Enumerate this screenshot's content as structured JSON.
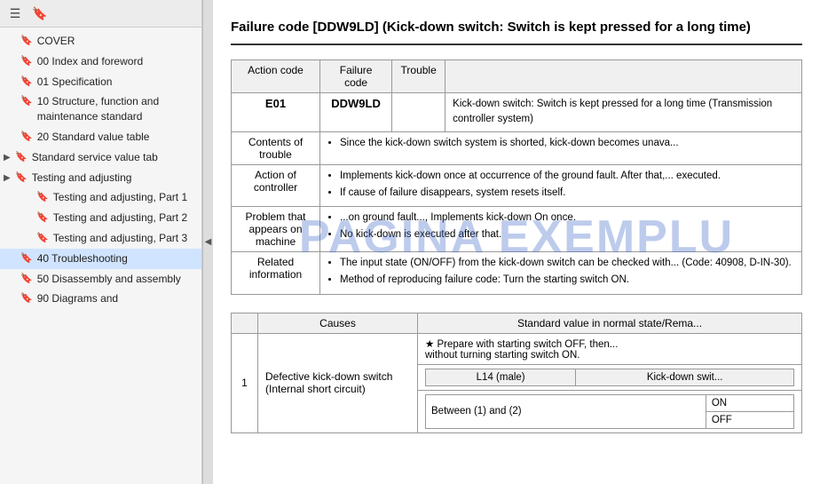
{
  "sidebar": {
    "toolbar": {
      "menu_icon": "☰",
      "bookmark_icon": "🔖"
    },
    "items": [
      {
        "id": "cover",
        "label": "COVER",
        "has_arrow": false,
        "active": false
      },
      {
        "id": "00-index",
        "label": "00 Index and foreword",
        "has_arrow": false,
        "active": false
      },
      {
        "id": "01-spec",
        "label": "01 Specification",
        "has_arrow": false,
        "active": false
      },
      {
        "id": "10-structure",
        "label": "10 Structure, function and maintenance standard",
        "has_arrow": false,
        "active": false
      },
      {
        "id": "20-standard",
        "label": "20 Standard value table",
        "has_arrow": false,
        "active": false
      },
      {
        "id": "standard-service",
        "label": "Standard service value tab",
        "has_arrow": true,
        "active": false
      },
      {
        "id": "testing-adjusting",
        "label": "Testing and adjusting",
        "has_arrow": true,
        "active": false
      },
      {
        "id": "testing-part1",
        "label": "Testing and adjusting, Part 1",
        "has_arrow": false,
        "active": false
      },
      {
        "id": "testing-part2",
        "label": "Testing and adjusting, Part 2",
        "has_arrow": false,
        "active": false
      },
      {
        "id": "testing-part3",
        "label": "Testing and adjusting, Part 3",
        "has_arrow": false,
        "active": false
      },
      {
        "id": "40-trouble",
        "label": "40 Troubleshooting",
        "has_arrow": false,
        "active": true
      },
      {
        "id": "50-disassembly",
        "label": "50 Disassembly and assembly",
        "has_arrow": false,
        "active": false
      },
      {
        "id": "90-diagrams",
        "label": "90 Diagrams and",
        "has_arrow": false,
        "active": false
      }
    ]
  },
  "main": {
    "title": "Failure code [DDW9LD] (Kick-down switch: Switch is kept pressed for a long time)",
    "title_short": "Failure code [DDW9LD] (Kick-down switch: Switch is ke...",
    "watermark": "PAGINA EXEMPLU",
    "first_table": {
      "headers": {
        "action_code": "Action code",
        "failure_code": "Failure code",
        "trouble": "Trouble"
      },
      "row1": {
        "action_code": "E01",
        "failure_code": "DDW9LD",
        "trouble_desc": "Kick-down switch: Switch is kept pressed for a long time (Transmission controller system)"
      },
      "rows": [
        {
          "header": "Contents of trouble",
          "bullets": [
            "Since the kick-down switch system is shorted, kick-down becomes unava..."
          ]
        },
        {
          "header": "Action of controller",
          "bullets": [
            "Implements kick-down once at occurrence of the ground fault. After that,... executed.",
            "If cause of failure disappears, system resets itself."
          ]
        },
        {
          "header": "Problem that appears on machine",
          "bullets": [
            "...on ground fault..., Implements kick-down On once.",
            "No kick-down is executed after that."
          ]
        },
        {
          "header": "Related information",
          "bullets": [
            "The input state (ON/OFF) from the kick-down switch can be checked with... (Code: 40908, D-IN-30).",
            "Method of reproducing failure code: Turn the starting switch ON."
          ]
        }
      ]
    },
    "second_table": {
      "headers": {
        "num": "",
        "causes": "Causes",
        "standard_value": "Standard value in normal state/Rema..."
      },
      "rows": [
        {
          "num": "1",
          "causes": "Defective kick-down switch (Internal short circuit)",
          "sub_rows": [
            {
              "condition": "★ Prepare with starting switch OFF, then...\nwithout turning starting switch ON.",
              "label": "",
              "col1": "",
              "col2": ""
            },
            {
              "condition": "",
              "label": "L14 (male)",
              "col1": "Kick-down swit..."
            },
            {
              "condition": "",
              "label": "Between (1) and (2)",
              "col1": "ON",
              "col2": ""
            },
            {
              "condition": "",
              "label": "",
              "col1": "OFF",
              "col2": ""
            }
          ]
        }
      ]
    }
  }
}
